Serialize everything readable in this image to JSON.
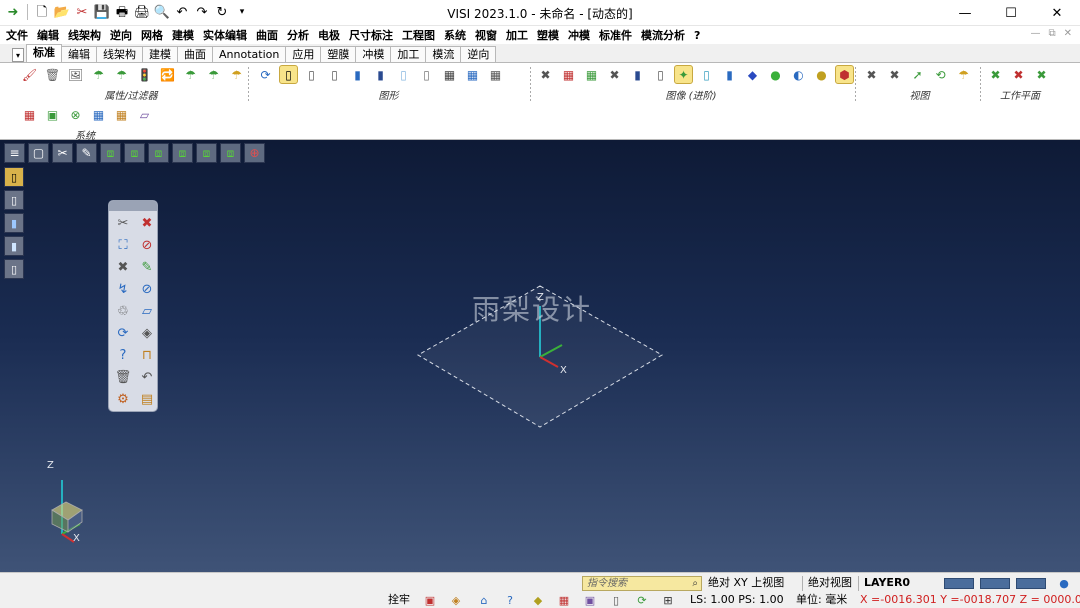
{
  "window": {
    "title": "VISI 2023.1.0 - 未命名 - [动态的]",
    "minimize": "—",
    "maximize": "☐",
    "close": "✕"
  },
  "quick_access": [
    "➜",
    "🗋",
    "📂",
    "✂",
    "💾",
    "🖶",
    "🖨",
    "🔍",
    "↶",
    "↷",
    "↻",
    "▾"
  ],
  "menu": [
    "文件",
    "编辑",
    "线架构",
    "逆向",
    "网格",
    "建模",
    "实体编辑",
    "曲面",
    "分析",
    "电极",
    "尺寸标注",
    "工程图",
    "系统",
    "视窗",
    "加工",
    "塑模",
    "冲模",
    "标准件",
    "模流分析",
    "?"
  ],
  "mdi_controls": [
    "—",
    "⧉",
    "✕"
  ],
  "ribbon_tabs": {
    "arrow": "▾",
    "items": [
      "标准",
      "编辑",
      "线架构",
      "建模",
      "曲面",
      "Annotation",
      "应用",
      "塑膜",
      "冲模",
      "加工",
      "模流",
      "逆向"
    ],
    "active": "标准"
  },
  "ribbon_groups": [
    {
      "label": "属性/过滤器",
      "icons": [
        "🖌",
        "🗑",
        "🖼",
        "☂",
        "☂",
        "🚦",
        "🔁",
        "☂",
        "☂",
        "☂"
      ]
    },
    {
      "label": "图形",
      "icons": [
        "⟳",
        "▯",
        "▯",
        "▯",
        "▮",
        "▮",
        "▯",
        "▯",
        "▦",
        "▦",
        "▦"
      ]
    },
    {
      "label": "图像 (进阶)",
      "icons": [
        "✖",
        "▦",
        "▦",
        "✖",
        "▮",
        "▯",
        "✦",
        "▯",
        "▮",
        "◆",
        "●",
        "◐",
        "●",
        "⬢"
      ]
    },
    {
      "label": "视图",
      "icons": [
        "✖",
        "✖",
        "➚",
        "⟲",
        "☂"
      ]
    },
    {
      "label": "工作平面",
      "icons": [
        "✖",
        "✖",
        "✖"
      ]
    },
    {
      "label": "系统",
      "icons": [
        "▦",
        "▣",
        "⊗",
        "▦",
        "▦",
        "▱"
      ]
    }
  ],
  "viewport": {
    "toolbar_icons": [
      "≡",
      "▢",
      "✂",
      "✎",
      "⧈",
      "⧈",
      "⧈",
      "⧈",
      "⧈",
      "⧈",
      "⊕"
    ],
    "left_icons": [
      "▯",
      "▯",
      "▮",
      "▮",
      "▯"
    ],
    "floating_icons": [
      "✂",
      "✖",
      "⛶",
      "⊘",
      "✖",
      "✎",
      "↯",
      "⊘",
      "♲",
      "▱",
      "⟳",
      "◈",
      "?",
      "⊓",
      "🗑",
      "↶",
      "⚙",
      "▤"
    ],
    "watermark": "雨梨设计",
    "axis_center": {
      "z": "Z",
      "x": "X"
    },
    "axis_corner": {
      "z": "Z",
      "x": "X"
    }
  },
  "status": {
    "command_search_placeholder": "指令搜索",
    "view_mode": "绝对 XY 上视图",
    "abs_view": "绝对视图",
    "layer": "LAYER0",
    "snap": "拴牢",
    "ls_ps": "LS: 1.00 PS: 1.00",
    "unit": "单位: 毫米",
    "coords": "X =-0016.301 Y =-0018.707 Z = 0000.000"
  },
  "colors": {
    "viewport_top": "#0e1a36",
    "viewport_bottom": "#3f5377",
    "accent_yellow": "#f6e8a0",
    "coord_red": "#d02020"
  }
}
